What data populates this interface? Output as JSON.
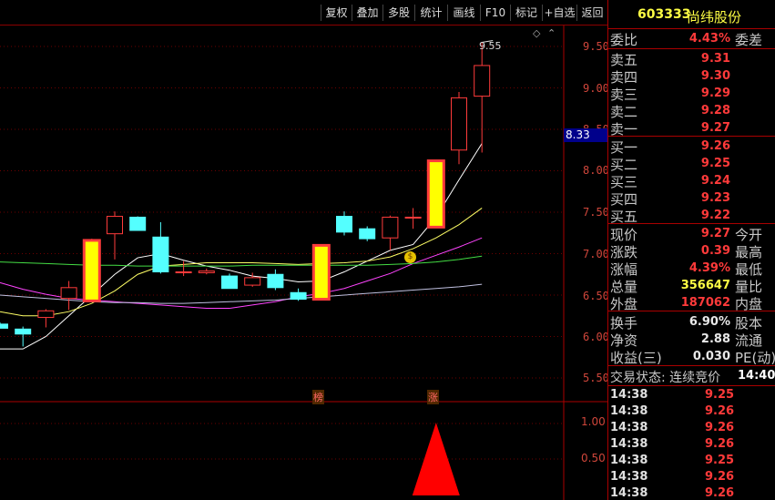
{
  "toolbar": {
    "buttons": [
      "复权",
      "叠加",
      "多股",
      "统计",
      "画线",
      "F10",
      "标记",
      "+自选",
      "返回"
    ]
  },
  "chart": {
    "max_label": "9.55",
    "y_ticks": [
      "9.50",
      "9.00",
      "8.50",
      "8.00",
      "7.50",
      "7.00",
      "6.50",
      "6.00",
      "5.50"
    ],
    "current_price_tag": "8.33",
    "markers": [
      "榜",
      "涨"
    ],
    "vol_ticks": [
      "1.00",
      "0.50"
    ],
    "colors": {
      "up": "#ff3b3b",
      "down": "#54ffff",
      "limit_up": "#ffff00",
      "ma5": "#ffffff",
      "ma10": "#ffff66",
      "ma20": "#ff44ff",
      "ma60": "#44dd44",
      "ma120": "#c0c0e0"
    },
    "candles": [
      {
        "o": 6.15,
        "h": 6.17,
        "l": 6.1,
        "c": 6.1,
        "limit": false
      },
      {
        "o": 6.09,
        "h": 6.12,
        "l": 5.88,
        "c": 6.03,
        "limit": false
      },
      {
        "o": 6.23,
        "h": 6.33,
        "l": 6.11,
        "c": 6.31,
        "limit": false
      },
      {
        "o": 6.46,
        "h": 6.67,
        "l": 6.32,
        "c": 6.59,
        "limit": false
      },
      {
        "o": 6.43,
        "h": 7.18,
        "l": 6.43,
        "c": 7.16,
        "limit": true
      },
      {
        "o": 7.24,
        "h": 7.51,
        "l": 6.93,
        "c": 7.45,
        "limit": false
      },
      {
        "o": 7.44,
        "h": 7.45,
        "l": 7.28,
        "c": 7.28,
        "limit": false
      },
      {
        "o": 7.2,
        "h": 7.38,
        "l": 6.76,
        "c": 6.78,
        "limit": false
      },
      {
        "o": 6.78,
        "h": 6.91,
        "l": 6.73,
        "c": 6.78,
        "limit": false
      },
      {
        "o": 6.77,
        "h": 6.82,
        "l": 6.75,
        "c": 6.79,
        "limit": false
      },
      {
        "o": 6.73,
        "h": 6.76,
        "l": 6.58,
        "c": 6.58,
        "limit": false
      },
      {
        "o": 6.62,
        "h": 6.77,
        "l": 6.6,
        "c": 6.71,
        "limit": false
      },
      {
        "o": 6.75,
        "h": 6.81,
        "l": 6.56,
        "c": 6.59,
        "limit": false
      },
      {
        "o": 6.53,
        "h": 6.58,
        "l": 6.43,
        "c": 6.45,
        "limit": false
      },
      {
        "o": 6.45,
        "h": 7.1,
        "l": 6.45,
        "c": 7.1,
        "limit": true
      },
      {
        "o": 7.45,
        "h": 7.51,
        "l": 7.22,
        "c": 7.26,
        "limit": false
      },
      {
        "o": 7.3,
        "h": 7.33,
        "l": 7.15,
        "c": 7.18,
        "limit": false
      },
      {
        "o": 7.19,
        "h": 7.46,
        "l": 7.04,
        "c": 7.44,
        "limit": false
      },
      {
        "o": 7.44,
        "h": 7.55,
        "l": 7.3,
        "c": 7.44,
        "limit": false
      },
      {
        "o": 7.32,
        "h": 8.12,
        "l": 7.32,
        "c": 8.12,
        "limit": true
      },
      {
        "o": 8.25,
        "h": 8.95,
        "l": 8.08,
        "c": 8.88,
        "limit": false
      },
      {
        "o": 8.9,
        "h": 9.55,
        "l": 8.22,
        "c": 9.27,
        "limit": false
      }
    ],
    "ma": {
      "ma5": [
        5.85,
        5.85,
        6.0,
        6.25,
        6.5,
        6.75,
        6.95,
        7.0,
        6.92,
        6.85,
        6.8,
        6.73,
        6.7,
        6.66,
        6.67,
        6.78,
        6.91,
        7.04,
        7.11,
        7.44,
        7.89,
        8.33
      ],
      "ma10": [
        6.3,
        6.25,
        6.25,
        6.3,
        6.4,
        6.55,
        6.75,
        6.85,
        6.87,
        6.89,
        6.89,
        6.89,
        6.88,
        6.87,
        6.88,
        6.89,
        6.91,
        6.96,
        7.06,
        7.19,
        7.35,
        7.55
      ],
      "ma20": [
        6.65,
        6.57,
        6.51,
        6.46,
        6.44,
        6.42,
        6.4,
        6.38,
        6.36,
        6.34,
        6.34,
        6.38,
        6.42,
        6.48,
        6.52,
        6.58,
        6.67,
        6.76,
        6.88,
        6.98,
        7.08,
        7.19
      ],
      "ma60": [
        6.9,
        6.89,
        6.88,
        6.87,
        6.86,
        6.86,
        6.85,
        6.85,
        6.85,
        6.85,
        6.85,
        6.86,
        6.86,
        6.86,
        6.86,
        6.86,
        6.86,
        6.87,
        6.88,
        6.9,
        6.93,
        6.97
      ],
      "ma120": [
        6.5,
        6.48,
        6.46,
        6.44,
        6.42,
        6.41,
        6.41,
        6.4,
        6.4,
        6.41,
        6.42,
        6.43,
        6.44,
        6.46,
        6.48,
        6.5,
        6.52,
        6.54,
        6.56,
        6.58,
        6.6,
        6.63
      ]
    },
    "vol_value": 1.0
  },
  "quote": {
    "code": "603333",
    "name": "尚纬股份",
    "weibi_label": "委比",
    "weibi_val": "4.43%",
    "weicha_label": "委差",
    "asks": [
      {
        "label": "卖五",
        "price": "9.31"
      },
      {
        "label": "卖四",
        "price": "9.30"
      },
      {
        "label": "卖三",
        "price": "9.29"
      },
      {
        "label": "卖二",
        "price": "9.28"
      },
      {
        "label": "卖一",
        "price": "9.27"
      }
    ],
    "bids": [
      {
        "label": "买一",
        "price": "9.26"
      },
      {
        "label": "买二",
        "price": "9.25"
      },
      {
        "label": "买三",
        "price": "9.24"
      },
      {
        "label": "买四",
        "price": "9.23"
      },
      {
        "label": "买五",
        "price": "9.22"
      }
    ],
    "stats": [
      {
        "l": "现价",
        "v": "9.27",
        "r": "今开",
        "color": "#ff3a3a"
      },
      {
        "l": "涨跌",
        "v": "0.39",
        "r": "最高",
        "color": "#ff3a3a"
      },
      {
        "l": "涨幅",
        "v": "4.39%",
        "r": "最低",
        "color": "#ff3a3a"
      },
      {
        "l": "总量",
        "v": "356647",
        "r": "量比",
        "color": "#ffff44"
      },
      {
        "l": "外盘",
        "v": "187062",
        "r": "内盘",
        "color": "#ff3a3a"
      }
    ],
    "stats2": [
      {
        "l": "换手",
        "v": "6.90%",
        "r": "股本"
      },
      {
        "l": "净资",
        "v": "2.88",
        "r": "流通"
      },
      {
        "l": "收益(三)",
        "v": "0.030",
        "r": "PE(动)"
      }
    ],
    "trade_status": "交易状态: 连续竞价",
    "trade_time": "14:40:",
    "ticks": [
      {
        "t": "14:38",
        "p": "9.25"
      },
      {
        "t": "14:38",
        "p": "9.26"
      },
      {
        "t": "14:38",
        "p": "9.26"
      },
      {
        "t": "14:38",
        "p": "9.26"
      },
      {
        "t": "14:38",
        "p": "9.25"
      },
      {
        "t": "14:38",
        "p": "9.26"
      },
      {
        "t": "14:38",
        "p": "9.26"
      }
    ]
  }
}
